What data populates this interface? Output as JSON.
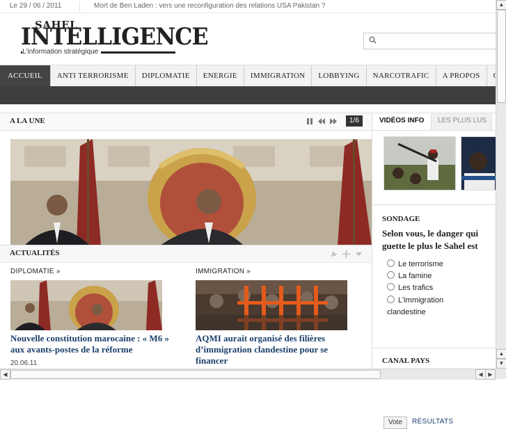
{
  "topbar": {
    "date": "Le 29 / 06 / 2011",
    "ticker": "Mort de Ben Laden : vers une reconfiguration des relations USA Pakistan ?"
  },
  "logo": {
    "line1": "SAHEL",
    "line2": "INTELLIGENCE",
    "tagline": "L'information stratégique"
  },
  "search": {
    "value": "",
    "icon": "search-icon"
  },
  "nav": {
    "items": [
      "ACCUEIL",
      "ANTI TERRORISME",
      "DIPLOMATIE",
      "ENERGIE",
      "IMMIGRATION",
      "LOBBYING",
      "NARCOTRAFIC",
      "A PROPOS",
      "CONT"
    ],
    "active": "ACCUEIL"
  },
  "une": {
    "title": "A LA UNE",
    "pager": "1/6",
    "controls": [
      "pause-icon",
      "prev-icon",
      "next-icon"
    ]
  },
  "actualites": {
    "title": "ACTUALITÉS",
    "tools": [
      "wrench-icon",
      "move-icon",
      "collapse-icon"
    ],
    "columns": [
      {
        "category": "DIPLOMATIE »",
        "headline": "Nouvelle constitution marocaine : « M6 » aux avants-postes de la réforme",
        "date": "20.06.11"
      },
      {
        "category": "IMMIGRATION »",
        "headline": "AQMI aurait organisé des filières d’immigration clandestine pour se financer",
        "date": ""
      }
    ]
  },
  "sidebar": {
    "tabs": [
      "VIDÉOS INFO",
      "LES PLUS LUS"
    ],
    "sondage": {
      "title": "SONDAGE",
      "question": "Selon vous, le danger qui guette le plus le Sahel est",
      "options": [
        "Le terrorisme",
        "La famine",
        "Les trafics",
        "L'immigration clandestine"
      ],
      "vote_label": "Vote",
      "results_label": "RÉSULTATS"
    },
    "canal_pays": "CANAL PAYS"
  },
  "colors": {
    "nav_active": "#444444",
    "dark_band": "#3e3e3e",
    "headline_blue": "#1a3f6b"
  }
}
